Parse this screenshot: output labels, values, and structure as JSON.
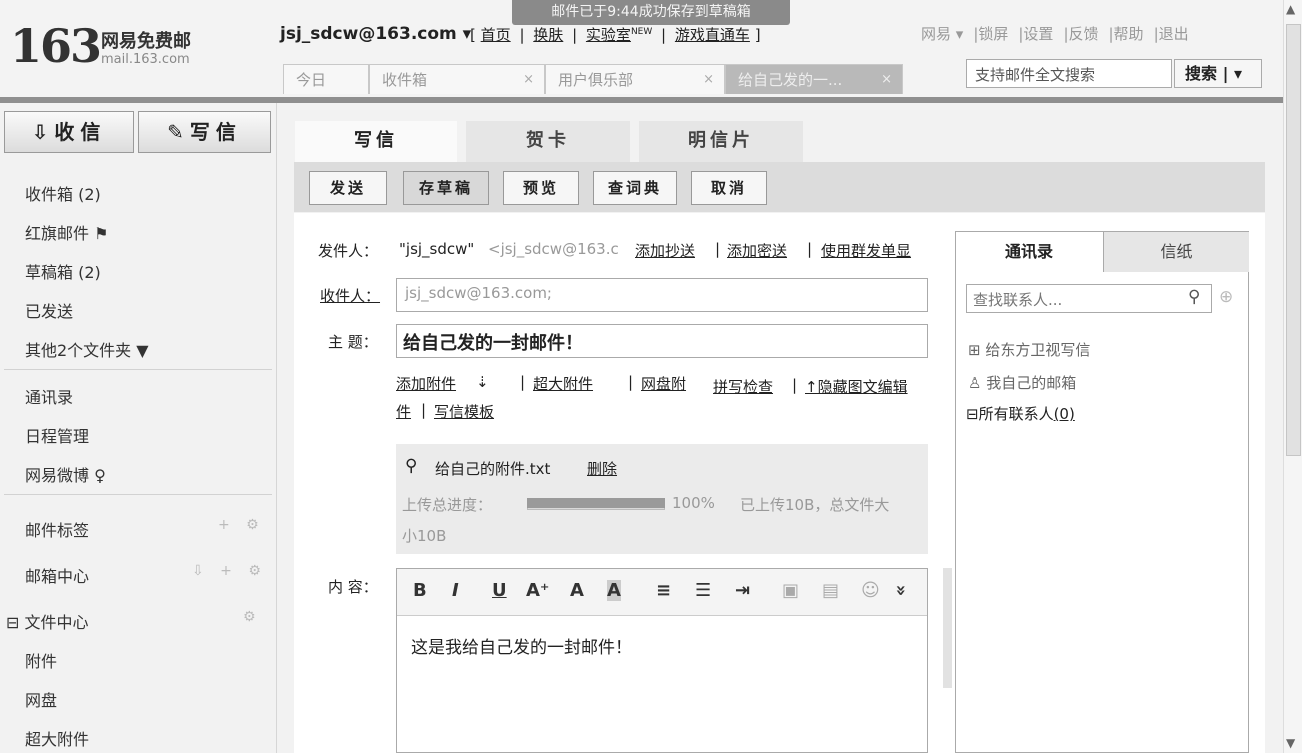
{
  "toast": "邮件已于9:44成功保存到草稿箱",
  "logo": {
    "number": "163",
    "title": "网易免费邮",
    "subtitle": "mail.163.com"
  },
  "account": "jsj_sdcw@163.com ▾",
  "top_nav": {
    "open": "[",
    "home": "首页",
    "sep": "|",
    "skin": "换肤",
    "lab": "实验室",
    "new_badge": "NEW",
    "game": "游戏直通车",
    "close": "]"
  },
  "util_nav": [
    "网易 ▾",
    "|锁屏",
    "|设置",
    "|反馈",
    "|帮助",
    "|退出"
  ],
  "tabs": [
    {
      "label": "今日",
      "close": ""
    },
    {
      "label": "收件箱",
      "close": "×"
    },
    {
      "label": "用户俱乐部",
      "close": "×"
    },
    {
      "label": "给自己发的一...",
      "close": "×"
    }
  ],
  "search": {
    "placeholder": "支持邮件全文搜索",
    "button": "搜索 | ▾"
  },
  "sidebar": {
    "receive": "收信",
    "compose": "写信",
    "items": [
      "收件箱 (2)",
      "红旗邮件 ⚑",
      "草稿箱 (2)",
      "已发送",
      "其他2个文件夹 ▼"
    ],
    "items2": [
      "通讯录",
      "日程管理",
      "网易微博 ♀"
    ],
    "groups": [
      "邮件标签",
      "邮箱中心",
      "⊟ 文件中心"
    ],
    "group_icons": [
      "+ ⚙",
      "⇩ + ⚙",
      "⚙"
    ],
    "files": [
      "附件",
      "网盘",
      "超大附件"
    ]
  },
  "compose_tabs": [
    "写信",
    "贺卡",
    "明信片"
  ],
  "toolbar": [
    "发送",
    "存草稿",
    "预览",
    "查词典",
    "取消"
  ],
  "sender": {
    "label": "发件人：",
    "name": "\"jsj_sdcw\"",
    "email": "<jsj_sdcw@163.c",
    "add_cc": "添加抄送",
    "add_bcc": "添加密送",
    "group_single": "使用群发单显",
    "sep": "|"
  },
  "recipient": {
    "label": "收件人：",
    "value": "jsj_sdcw@163.com;"
  },
  "subject": {
    "label": "主 题：",
    "value": "给自己发的一封邮件！"
  },
  "attach_links": {
    "add": "添加附件",
    "big": "超大附件",
    "netdisk": "网盘附",
    "netdisk2": "件",
    "template": "写信模板",
    "spell": "拼写检查",
    "hide": "↑隐藏图文编辑",
    "down": "⇣",
    "sep": "|",
    "sep2": "|"
  },
  "attachment": {
    "name": "给自己的附件.txt",
    "delete": "删除",
    "progress_label": "上传总进度：",
    "progress_percent": "100%",
    "uploaded": "已上传10B，总文件大",
    "size_line2": "小10B",
    "progress_fraction": 1.0
  },
  "content": {
    "label": "内 容：",
    "body": "这是我给自己发的一封邮件！"
  },
  "editor_buttons": [
    "B",
    "I",
    "U",
    "A⁺",
    "A",
    "A",
    "≡",
    "☰",
    "⇥",
    "▣",
    "▤",
    "☺",
    "»"
  ],
  "contacts": {
    "tab_book": "通讯录",
    "tab_paper": "信纸",
    "search_placeholder": "查找联系人...",
    "items": [
      "给东方卫视写信",
      "我自己的邮箱"
    ],
    "all_label": "⊟所有联系人",
    "all_count": "(0)"
  }
}
